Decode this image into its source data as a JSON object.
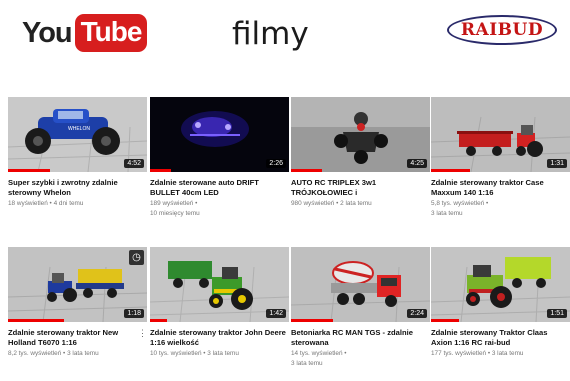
{
  "header": {
    "youtube_logo": {
      "you": "You",
      "tube": "Tube"
    },
    "heading": "filmy",
    "brand_logo": "RAIBUD"
  },
  "colors": {
    "youtube_red": "#d71e1e",
    "progress_red": "#e00000",
    "brand_red": "#c41515",
    "brand_border": "#2a2a6a"
  },
  "videos": [
    {
      "title": "Super szybki i zwrotny zdalnie sterowny Whelon",
      "meta1": "18 wyświetleń • 4 dni temu",
      "meta2": "",
      "duration": "4:52",
      "progress": 0.3,
      "thumb": "blue-monster-truck"
    },
    {
      "title": "Zdalnie sterowane auto DRIFT BULLET 40cm LED",
      "meta1": "189 wyświetleń •",
      "meta2": "10 miesięcy temu",
      "duration": "2:26",
      "progress": 0.15,
      "thumb": "led-car-dark"
    },
    {
      "title": "AUTO RC TRIPLEX 3w1 TRÓJKOŁOWIEC i",
      "meta1": "980 wyświetleń • 2 lata temu",
      "meta2": "",
      "duration": "4:25",
      "progress": 0.22,
      "thumb": "triplex-rc"
    },
    {
      "title": "Zdalnie sterowany traktor Case Maxxum 140 1:16",
      "meta1": "5,8 tys. wyświetleń •",
      "meta2": "3 lata temu",
      "duration": "1:31",
      "progress": 0.28,
      "thumb": "red-tractor"
    },
    {
      "title": "Zdalnie sterowany traktor New Holland T6070 1:16",
      "meta1": "8,2 tys. wyświetleń • 3 lata temu",
      "meta2": "",
      "duration": "1:18",
      "progress": 0.4,
      "thumb": "blue-tractor",
      "has_clock": true
    },
    {
      "title": "Zdalnie sterowany traktor John Deere 1:16 wielkość",
      "meta1": "10 tys. wyświetleń • 3 lata temu",
      "meta2": "",
      "duration": "1:42",
      "progress": 0.12,
      "thumb": "green-tractor"
    },
    {
      "title": "Betoniarka RC MAN TGS - zdalnie sterowana",
      "meta1": "14 tys. wyświetleń •",
      "meta2": "3 lata temu",
      "duration": "2:24",
      "progress": 0.3,
      "thumb": "cement-mixer"
    },
    {
      "title": "Zdalnie sterowany Traktor Claas Axion 1:16 RC rai-bud",
      "meta1": "177 tys. wyświetleń • 3 lata temu",
      "meta2": "",
      "duration": "1:51",
      "progress": 0.2,
      "thumb": "claas-tractor"
    }
  ],
  "more_menu": "⋮"
}
